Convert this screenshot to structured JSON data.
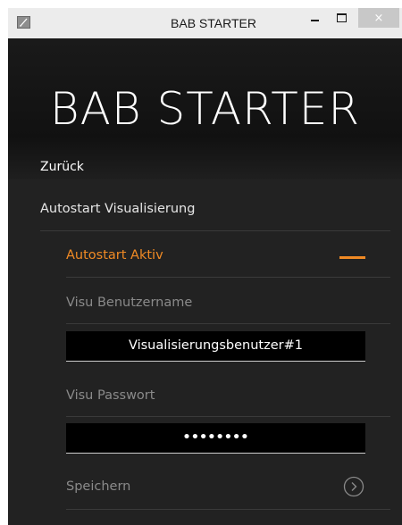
{
  "window": {
    "title": "BAB STARTER",
    "minimize_glyph": "minimize-icon",
    "maximize_glyph": "maximize-icon",
    "close_glyph": "×"
  },
  "header": {
    "app_title": "BAB STARTER",
    "back_label": "Zurück"
  },
  "settings": {
    "section_label": "Autostart Visualisierung",
    "autostart_label": "Autostart Aktiv",
    "autostart_active": true,
    "username_label": "Visu Benutzername",
    "username_value": "Visualisierungsbenutzer#1",
    "password_label": "Visu Passwort",
    "password_value": "••••••••",
    "save_label": "Speichern",
    "save_icon": "chevron-right-circle-icon"
  },
  "colors": {
    "accent": "#f08a24",
    "background": "#222222",
    "muted_text": "#8a8a8a"
  }
}
